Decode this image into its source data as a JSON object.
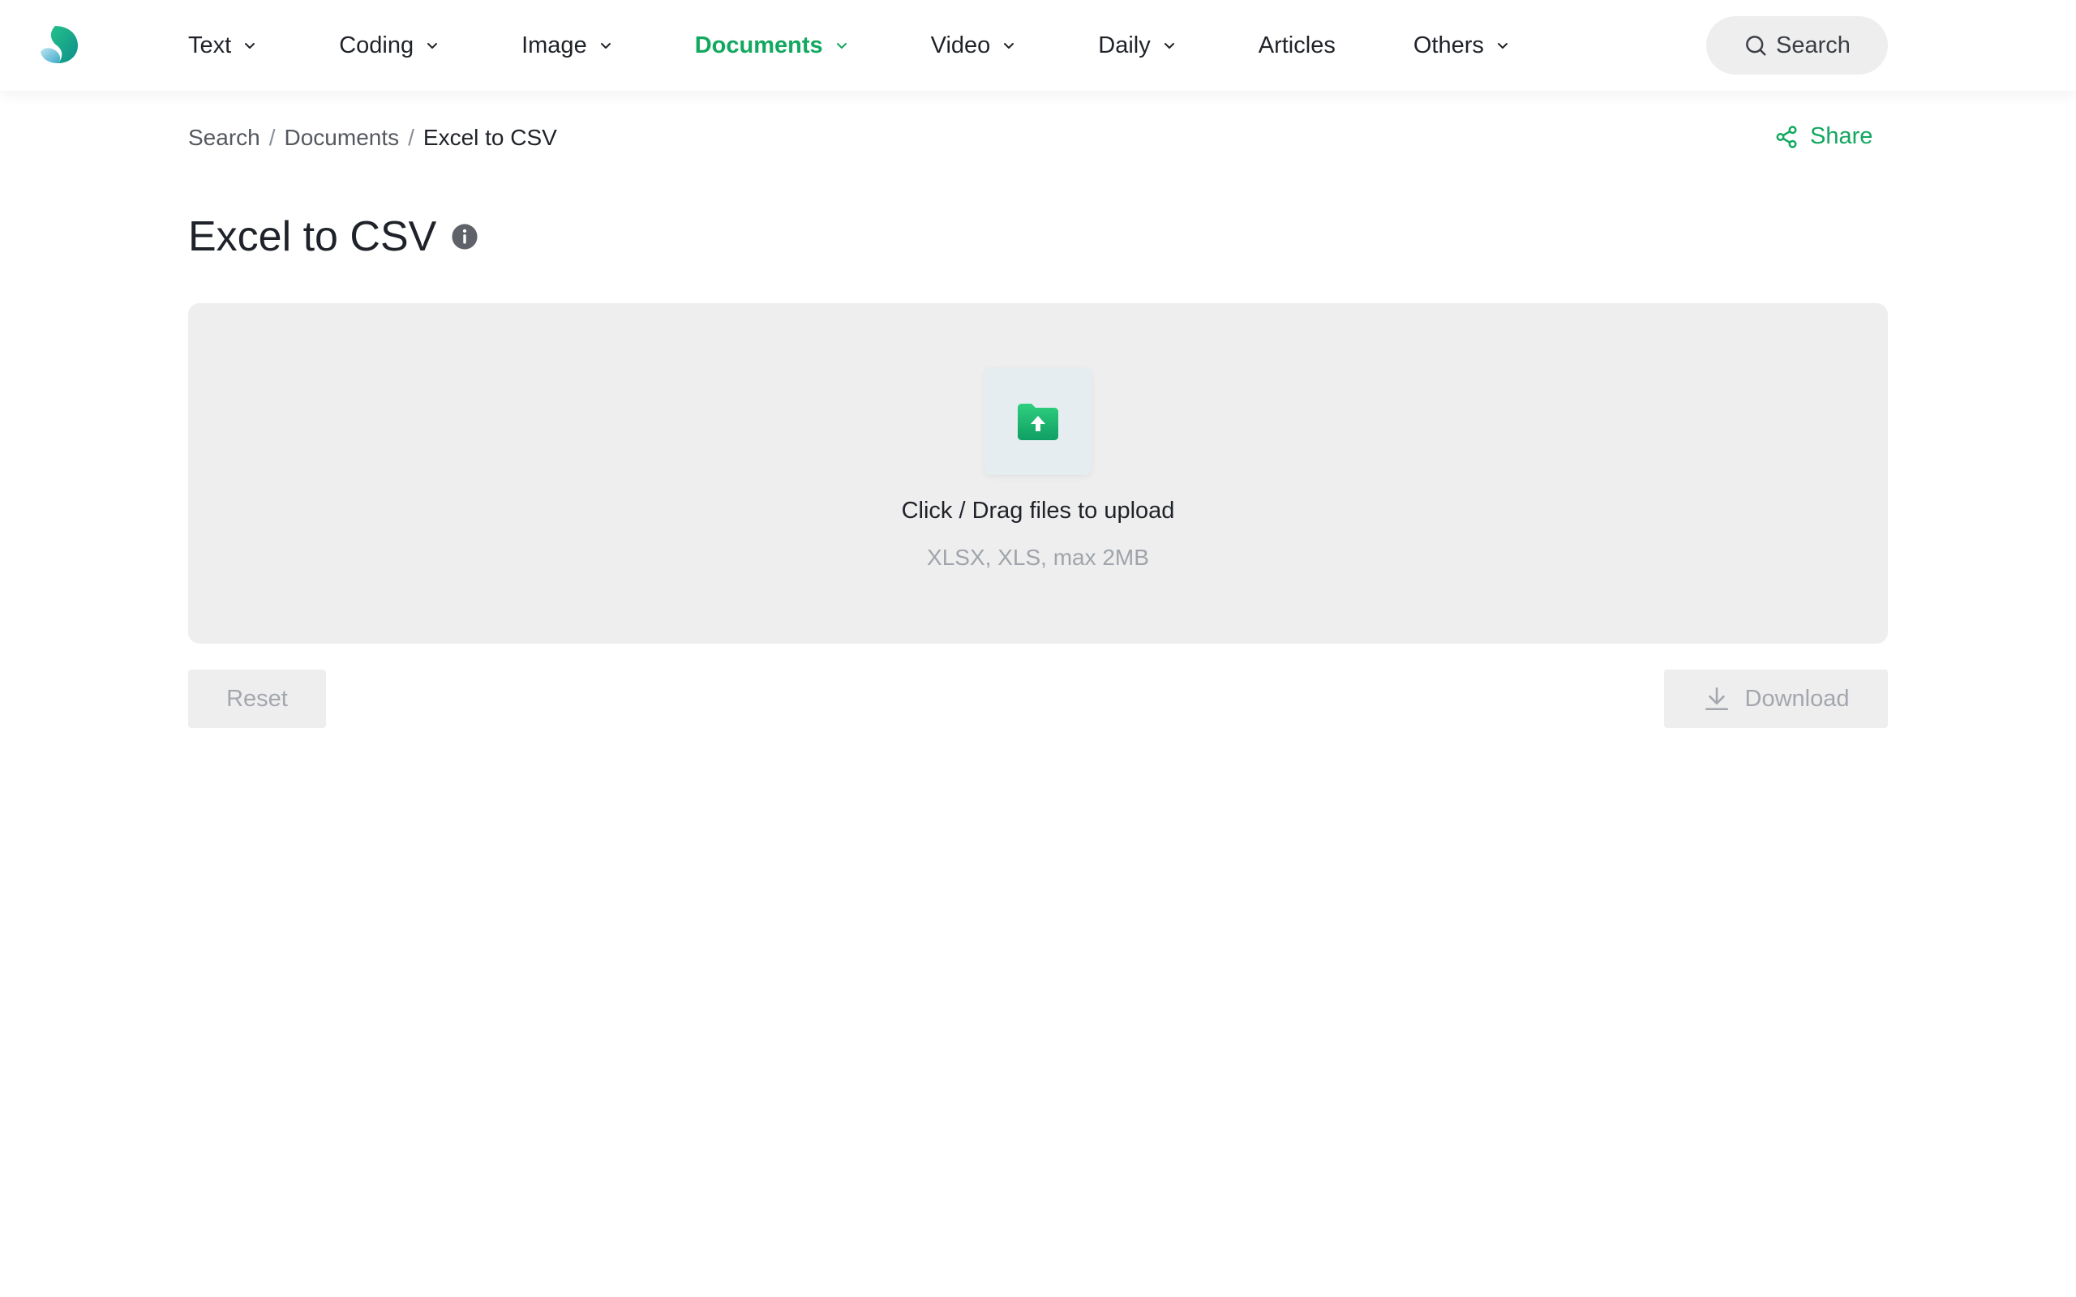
{
  "colors": {
    "accent": "#12a85f",
    "panel": "#eeeeee",
    "text": "#1f2329",
    "muted": "#a3a7ad"
  },
  "header": {
    "logo_icon": "brand-logo",
    "nav": [
      {
        "label": "Text",
        "dropdown": true,
        "active": false
      },
      {
        "label": "Coding",
        "dropdown": true,
        "active": false
      },
      {
        "label": "Image",
        "dropdown": true,
        "active": false
      },
      {
        "label": "Documents",
        "dropdown": true,
        "active": true
      },
      {
        "label": "Video",
        "dropdown": true,
        "active": false
      },
      {
        "label": "Daily",
        "dropdown": true,
        "active": false
      },
      {
        "label": "Articles",
        "dropdown": false,
        "active": false
      },
      {
        "label": "Others",
        "dropdown": true,
        "active": false
      }
    ],
    "search_label": "Search",
    "search_icon": "search-icon"
  },
  "breadcrumb": {
    "items": [
      "Search",
      "Documents",
      "Excel to CSV"
    ],
    "separator": "/"
  },
  "share": {
    "label": "Share",
    "icon": "share-icon"
  },
  "page": {
    "title": "Excel to CSV",
    "info_icon": "info-icon"
  },
  "upload": {
    "icon": "folder-upload-icon",
    "prompt": "Click / Drag files to upload",
    "hint": "XLSX, XLS, max 2MB"
  },
  "actions": {
    "reset_label": "Reset",
    "download_label": "Download",
    "download_icon": "download-icon"
  }
}
